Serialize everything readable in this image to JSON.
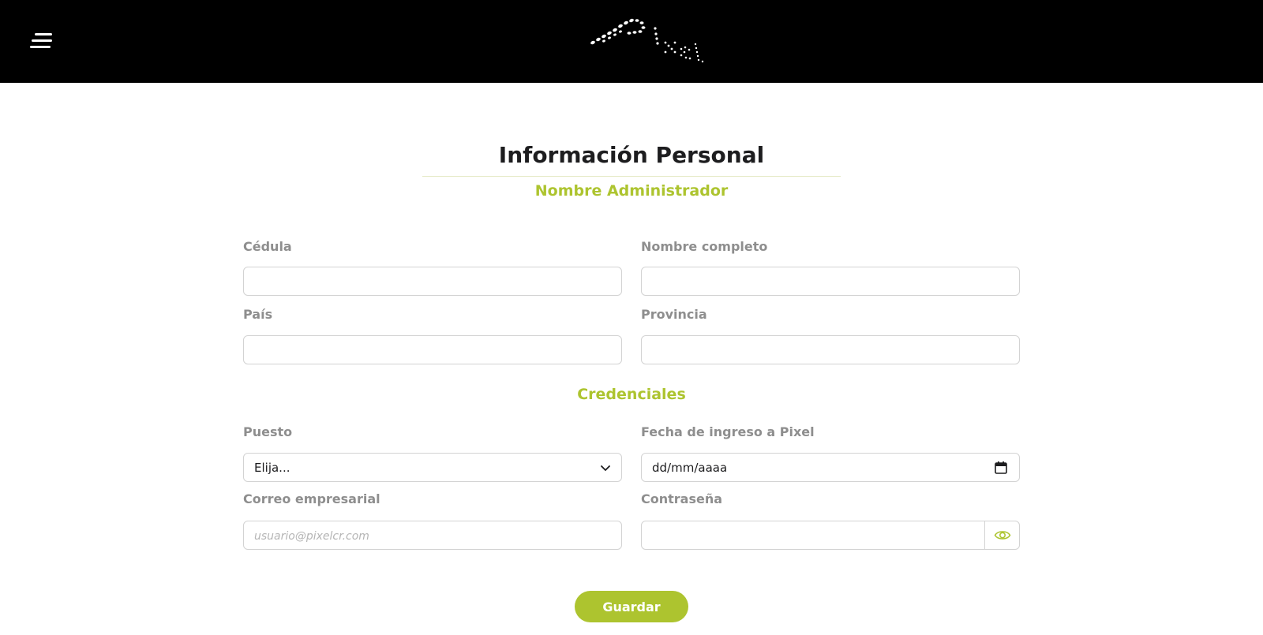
{
  "header": {
    "menu_icon": "hamburger-menu-icon",
    "logo_text": "Pixel",
    "background": "#000000"
  },
  "form": {
    "title": "Información Personal",
    "personal_section": "Nombre Administrador",
    "credentials_section": "Credenciales",
    "fields": {
      "cedula": {
        "label": "Cédula",
        "value": ""
      },
      "nombre": {
        "label": "Nombre completo",
        "value": ""
      },
      "pais": {
        "label": "País",
        "value": ""
      },
      "provincia": {
        "label": "Provincia",
        "value": ""
      },
      "puesto": {
        "label": "Puesto",
        "value": "Elija..."
      },
      "fecha": {
        "label": "Fecha de ingreso a Pixel",
        "value": "dd/mm/aaaa"
      },
      "correo": {
        "label": "Correo empresarial",
        "placeholder": "usuario@pixelcr.com",
        "value": ""
      },
      "contrasena": {
        "label": "Contraseña",
        "value": ""
      }
    },
    "save_label": "Guardar"
  },
  "colors": {
    "accent": "#adc42f",
    "label": "#8e8e8e",
    "title": "#1d1d1f",
    "border": "#d3d3d3"
  }
}
